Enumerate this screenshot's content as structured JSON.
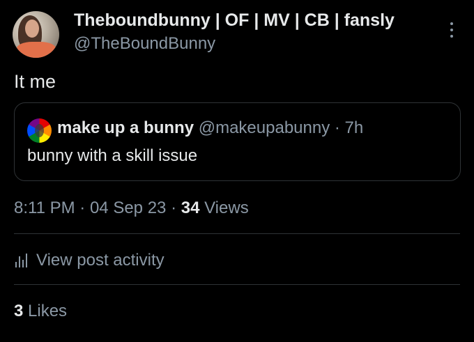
{
  "author": {
    "display_name": "Theboundbunny | OF | MV | CB | fansly",
    "handle": "@TheBoundBunny"
  },
  "tweet": {
    "text": "It me"
  },
  "quote": {
    "name": "make up a bunny",
    "handle": "@makeupabunny",
    "separator": "·",
    "time": "7h",
    "text": "bunny with a skill issue"
  },
  "meta": {
    "time": "8:11 PM",
    "sep1": "·",
    "date": "04 Sep 23",
    "sep2": "·",
    "views_count": "34",
    "views_label": "Views"
  },
  "activity": {
    "label": "View post activity",
    "icon": "bar-chart-icon"
  },
  "likes": {
    "count": "3",
    "label": "Likes"
  },
  "colors": {
    "background": "#000000",
    "primary_text": "#e7e9ea",
    "secondary_text": "#8b98a5",
    "border": "#2f3336"
  }
}
